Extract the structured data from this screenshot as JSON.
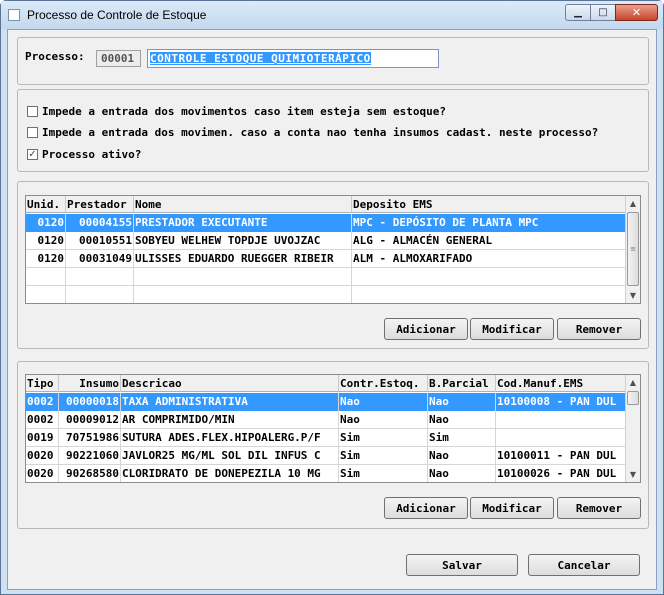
{
  "window": {
    "title": "Processo de Controle de Estoque",
    "controls": {
      "minimize": "▁",
      "maximize": "□",
      "close": "✕"
    }
  },
  "processo": {
    "label": "Processo:",
    "code": "00001",
    "name": "CONTROLE ESTOQUE QUIMIOTERÁPICO"
  },
  "options": [
    {
      "label": "Impede a entrada dos movimentos caso item esteja sem estoque?",
      "checked": false
    },
    {
      "label": "Impede a entrada dos movimen. caso a conta nao tenha insumos cadast. neste processo?",
      "checked": false
    },
    {
      "label": "Processo ativo?",
      "checked": true
    }
  ],
  "prestadores": {
    "columns": [
      "Unid.",
      "Prestador",
      "Nome",
      "Deposito EMS"
    ],
    "rows": [
      [
        "0120",
        "00004155",
        "PRESTADOR EXECUTANTE",
        "MPC - DEPÓSITO DE PLANTA MPC"
      ],
      [
        "0120",
        "00010551",
        "SOBYEU WELHEW TOPDJE UVOJZAC",
        "ALG - ALMACÉN GENERAL"
      ],
      [
        "0120",
        "00031049",
        "ULISSES EDUARDO RUEGGER RIBEIR",
        "ALM - ALMOXARIFADO"
      ],
      [
        "",
        "",
        "",
        ""
      ],
      [
        "",
        "",
        "",
        ""
      ]
    ],
    "selected_row": 0,
    "buttons": {
      "add": "Adicionar",
      "edit": "Modificar",
      "remove": "Remover"
    }
  },
  "insumos": {
    "columns": [
      "Tipo",
      "Insumo",
      "Descricao",
      "Contr.Estoq.",
      "B.Parcial",
      "Cod.Manuf.EMS"
    ],
    "rows": [
      [
        "0002",
        "00000018",
        "TAXA ADMINISTRATIVA",
        "Nao",
        "Nao",
        "10100008 - PAN DUL"
      ],
      [
        "0002",
        "00009012",
        "AR COMPRIMIDO/MIN",
        "Nao",
        "Nao",
        ""
      ],
      [
        "0019",
        "70751986",
        "SUTURA ADES.FLEX.HIPOALERG.P/F",
        "Sim",
        "Sim",
        ""
      ],
      [
        "0020",
        "90221060",
        "JAVLOR25 MG/ML SOL DIL INFUS C",
        "Sim",
        "Nao",
        "10100011 - PAN DUL"
      ],
      [
        "0020",
        "90268580",
        "CLORIDRATO DE DONEPEZILA 10 MG",
        "Sim",
        "Nao",
        "10100026 - PAN DUL"
      ]
    ],
    "selected_row": 0,
    "buttons": {
      "add": "Adicionar",
      "edit": "Modificar",
      "remove": "Remover"
    }
  },
  "footer": {
    "save": "Salvar",
    "cancel": "Cancelar"
  },
  "colors": {
    "selection": "#3399ff",
    "titlebar": "#c3d8ee",
    "close": "#c9442a"
  }
}
